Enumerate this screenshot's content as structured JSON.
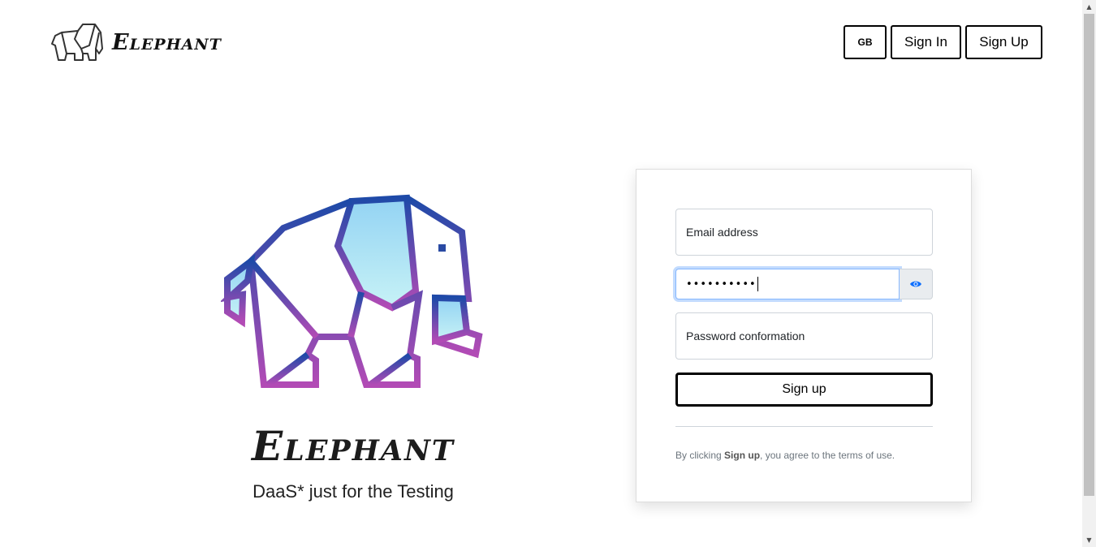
{
  "header": {
    "brand_name": "Elephant",
    "nav": {
      "lang": "GB",
      "signin": "Sign In",
      "signup": "Sign Up"
    }
  },
  "hero": {
    "title": "Elephant",
    "subtitle": "DaaS* just for the Testing"
  },
  "form": {
    "email_placeholder": "Email address",
    "password_value": "••••••••••",
    "password_confirm_placeholder": "Password conformation",
    "submit_label": "Sign up",
    "terms_prefix": "By clicking ",
    "terms_bold": "Sign up",
    "terms_suffix": ", you agree to the terms of use."
  },
  "icons": {
    "eye": "eye-icon",
    "brand": "elephant-logo-icon"
  },
  "colors": {
    "accent": "#0d6efd",
    "gradient_top": "#1e4aa8",
    "gradient_bottom": "#b24bb5",
    "fill_light": "#a7e4f5"
  }
}
